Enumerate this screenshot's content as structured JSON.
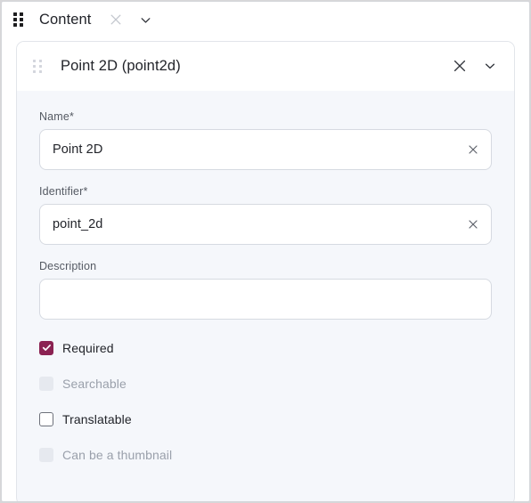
{
  "topbar": {
    "drag_handle_icon": "grid-drag-handle-icon",
    "title": "Content",
    "close_icon": "close-icon",
    "expand_icon": "chevron-down-icon"
  },
  "card": {
    "drag_handle_icon": "grid-drag-handle-icon",
    "title": "Point 2D (point2d)",
    "close_icon": "close-icon",
    "collapse_icon": "chevron-down-icon",
    "fields": [
      {
        "label": "Name*",
        "value": "Point 2D",
        "placeholder": "",
        "clear_icon": "clear-icon",
        "type": "text"
      },
      {
        "label": "Identifier*",
        "value": "point_2d",
        "placeholder": "",
        "clear_icon": "clear-icon",
        "type": "text"
      },
      {
        "label": "Description",
        "value": "",
        "placeholder": "",
        "type": "textarea"
      }
    ],
    "checkboxes": [
      {
        "label": "Required",
        "checked": true,
        "disabled": false
      },
      {
        "label": "Searchable",
        "checked": false,
        "disabled": true
      },
      {
        "label": "Translatable",
        "checked": false,
        "disabled": false
      },
      {
        "label": "Can be a thumbnail",
        "checked": false,
        "disabled": true
      }
    ]
  },
  "colors": {
    "accent": "#8b2252",
    "page_background": "#ffffff",
    "card_background": "#f5f7fb",
    "card_header_background": "#ffffff",
    "border": "#e2e5ea",
    "input_border": "#d6dae1",
    "text_primary": "#22242a",
    "text_muted": "#9aa0ab",
    "label": "#555a63"
  }
}
